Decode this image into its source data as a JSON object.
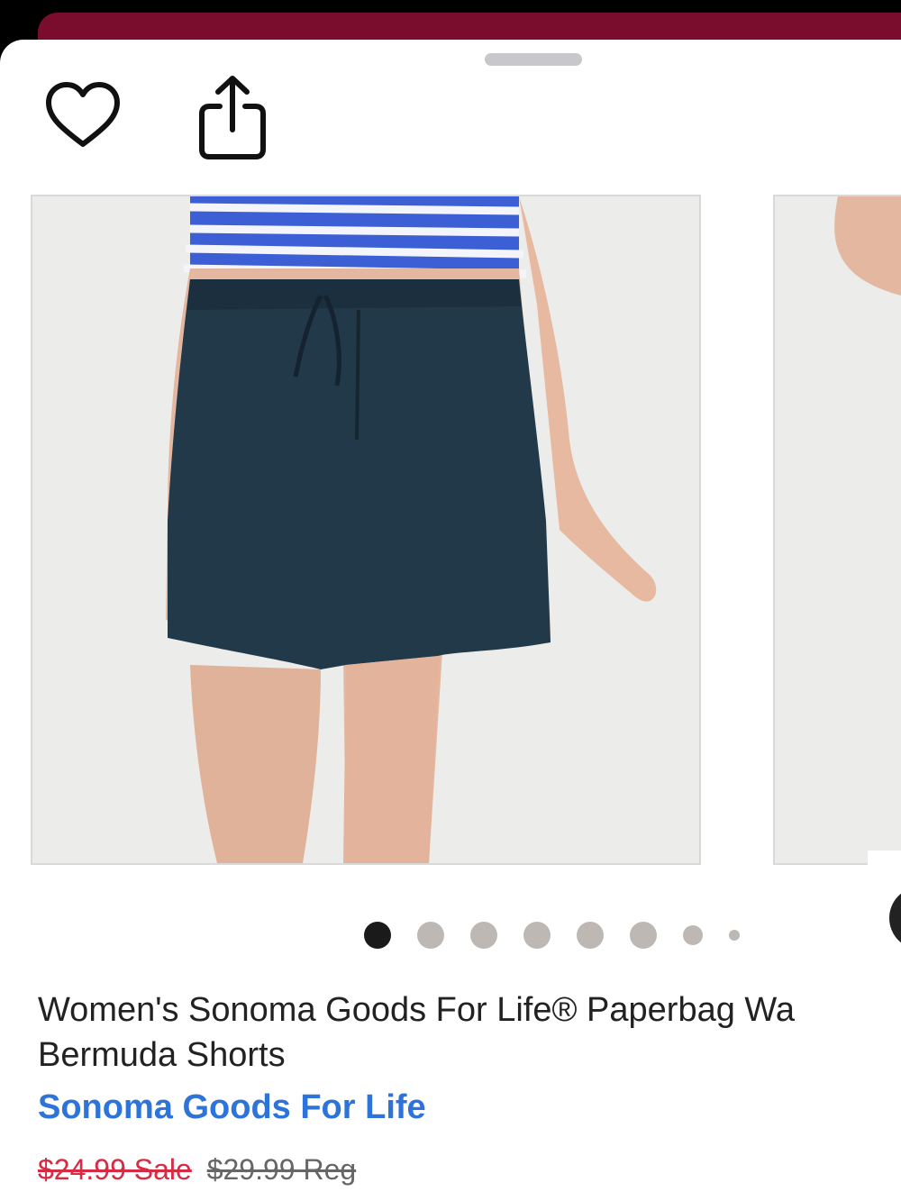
{
  "header": {
    "favorite_icon": "heart-outline-icon",
    "share_icon": "share-icon"
  },
  "gallery": {
    "image_count": 8,
    "active_index": 0,
    "image_alt": "Women's Sonoma Goods For Life® Paperbag Waist Bermuda Shorts",
    "next_arrow_icon": "chevron-right-icon"
  },
  "product": {
    "title_line1": "Women's Sonoma Goods For Life® Paperbag Wa",
    "title_line2": "Bermuda Shorts",
    "brand": "Sonoma Goods For Life",
    "sale_price": "$24.99 Sale",
    "regular_price": "$29.99 Reg"
  },
  "colors": {
    "accent_bar": "#7a0d2e",
    "brand_link": "#2d73d8",
    "sale_price": "#d62b42",
    "dot_active": "#1a1a1a",
    "dot_inactive": "#bdb8b3"
  }
}
